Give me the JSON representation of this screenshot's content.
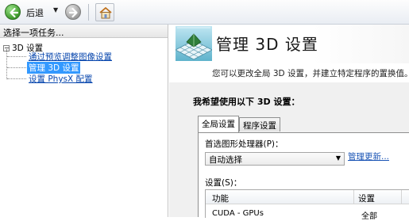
{
  "toolbar": {
    "back_label": "后退",
    "back_icon": "arrow-left-icon",
    "forward_icon": "arrow-right-icon",
    "home_icon": "home-icon"
  },
  "left_panel": {
    "header": "选择一项任务...",
    "tree": {
      "root_label": "3D 设置",
      "items": [
        {
          "label": "通过预览调整图像设置",
          "selected": false
        },
        {
          "label": "管理 3D 设置",
          "selected": true
        },
        {
          "label": "设置 PhysX 配置",
          "selected": false
        }
      ]
    }
  },
  "right_panel": {
    "banner_title": "管理 3D 设置",
    "banner_subtitle": "您可以更改全局 3D 设置，并建立特定程序的置换值。",
    "section_heading": "我希望使用以下 3D 设置：",
    "tabs": [
      {
        "label": "全局设置",
        "active": true
      },
      {
        "label": "程序设置",
        "active": false
      }
    ],
    "gpu_label": "首选图形处理器(P)：",
    "gpu_select_value": "自动选择",
    "manage_link": "管理更新...",
    "settings_label": "设置(S)：",
    "table": {
      "headers": [
        "功能",
        "设置"
      ],
      "rows": [
        [
          "CUDA - GPUs",
          "全部"
        ]
      ]
    }
  },
  "colors": {
    "selection": "#3399ff",
    "link": "#1a54b5",
    "back_button": "#3f9a2c"
  }
}
